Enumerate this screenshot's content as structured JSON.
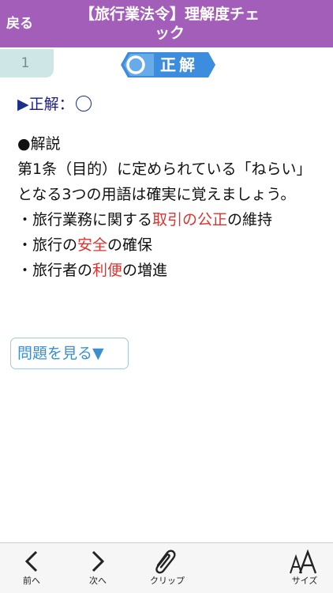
{
  "header": {
    "back_label": "戻る",
    "title_line1": "【旅行業法令】理解度チェ",
    "title_line2": "ック"
  },
  "question_tab": {
    "number": "1"
  },
  "result": {
    "label": "正解"
  },
  "answer": {
    "prefix": "▶",
    "label": "正解："
  },
  "explanation": {
    "heading": "●解説",
    "paragraph": "第1条（目的）に定められている「ねらい」となる3つの用語は確実に覚えましょう。",
    "items": [
      {
        "before": "・旅行業務に関する",
        "highlight": "取引の公正",
        "after": "の維持"
      },
      {
        "before": "・旅行の",
        "highlight": "安全",
        "after": "の確保"
      },
      {
        "before": "・旅行者の",
        "highlight": "利便",
        "after": "の増進"
      }
    ]
  },
  "show_question": {
    "label": "問題を見る",
    "arrow": "▼"
  },
  "toolbar": {
    "prev_label": "前へ",
    "next_label": "次へ",
    "clip_label": "クリップ",
    "size_label": "サイズ"
  },
  "colors": {
    "header": "#a25eb8",
    "highlight": "#e0322e",
    "badge": "#3d8ddf",
    "button_text": "#3b8ed0"
  }
}
